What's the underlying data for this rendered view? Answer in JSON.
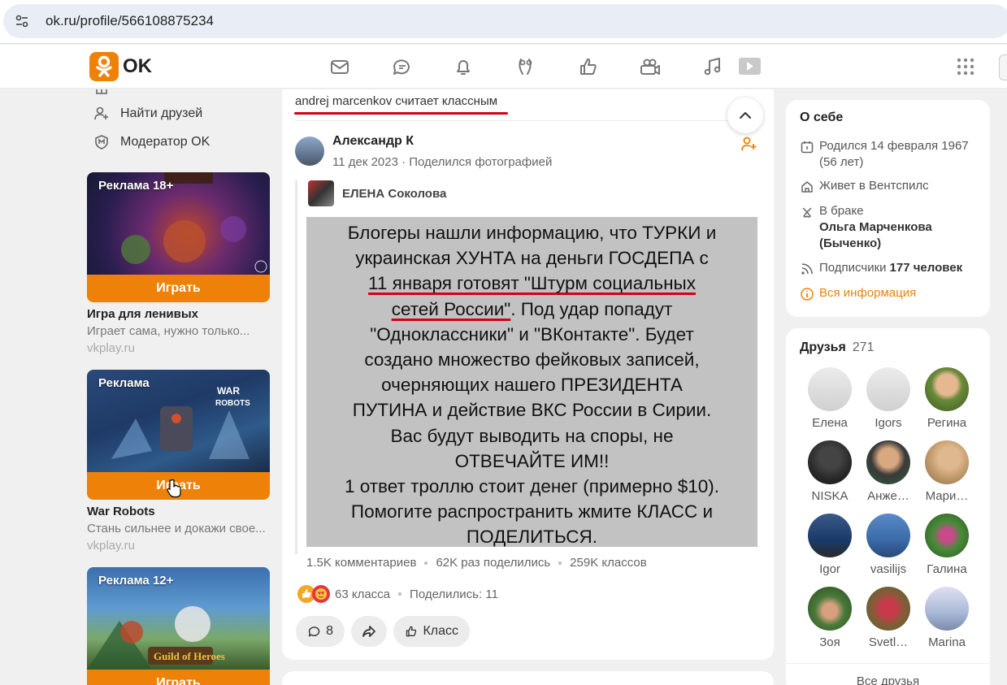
{
  "browser": {
    "url": "ok.ru/profile/566108875234"
  },
  "header": {
    "logo_text": "OK",
    "brand_color": "#ee8208"
  },
  "left_menu": {
    "items": [
      {
        "label": "Найти друзей"
      },
      {
        "label": "Модератор OK"
      }
    ]
  },
  "ads": [
    {
      "label": "Реклама 18+",
      "button": "Играть",
      "title": "Игра для ленивых",
      "desc": "Играет сама, нужно только...",
      "source": "vkplay.ru"
    },
    {
      "label": "Реклама",
      "button": "Играть",
      "title": "War Robots",
      "desc": "Стань сильнее и докажи свое...",
      "source": "vkplay.ru"
    },
    {
      "label": "Реклама 12+",
      "button": "Играть"
    }
  ],
  "feed": {
    "liker_name": "andrej marcenkov",
    "liker_action": " считает классным",
    "author": "Александр К",
    "meta": "11 дек 2023 · Поделился фотографией",
    "repost_author": "ЕЛЕНА Соколова",
    "image_text": {
      "l1": "Блогеры нашли информацию, что ТУРКИ и",
      "l2": "украинская ХУНТА на деньги ГОСДЕПА  с",
      "l3a": "11 января готовят \"Штурм социальных",
      "l4a": "сетей России\"",
      "l4b": ". Под удар попадут",
      "l5": "\"Одноклассники\" и \"ВКонтакте\". Будет",
      "l6": "создано множество фейковых записей,",
      "l7": "очерняющих нашего ПРЕЗИДЕНТА",
      "l8": "ПУТИНА и действие ВКС России в Сирии.",
      "l9": "Вас будут выводить на споры, не",
      "l10": "ОТВЕЧАЙТЕ ИМ!!",
      "l11": "1 ответ троллю стоит денег (примерно $10).",
      "l12": "Помогите распространить жмите КЛАСС и",
      "l13": "ПОДЕЛИТЬСЯ."
    },
    "stats": {
      "comments": "1.5K комментариев",
      "shares": "62K раз поделились",
      "likes": "259K классов"
    },
    "reactions": {
      "classes": "63 класса",
      "shared": "Поделились: 11"
    },
    "actions": {
      "comments_count": "8",
      "like_label": "Класс"
    }
  },
  "about": {
    "title": "О себе",
    "born": "Родился 14 февраля 1967",
    "age": "(56 лет)",
    "lives": "Живет в Вентспилс",
    "status": "В браке",
    "spouse_1": "Ольга Марченкова",
    "spouse_2": "(Быченко)",
    "subscribers_label": "Подписчики ",
    "subscribers_count": "177 человек",
    "all_info": "Вся информация",
    "accent": "#ee8208"
  },
  "friends": {
    "title": "Друзья",
    "count": "271",
    "list": [
      {
        "name": "Елена"
      },
      {
        "name": "Igors"
      },
      {
        "name": "Регина"
      },
      {
        "name": "NISKA"
      },
      {
        "name": "Анже…"
      },
      {
        "name": "Мари…"
      },
      {
        "name": "Igor"
      },
      {
        "name": "vasilijs"
      },
      {
        "name": "Галина"
      },
      {
        "name": "Зоя"
      },
      {
        "name": "Svetl…"
      },
      {
        "name": "Marina"
      }
    ],
    "all_link": "Все друзья"
  }
}
